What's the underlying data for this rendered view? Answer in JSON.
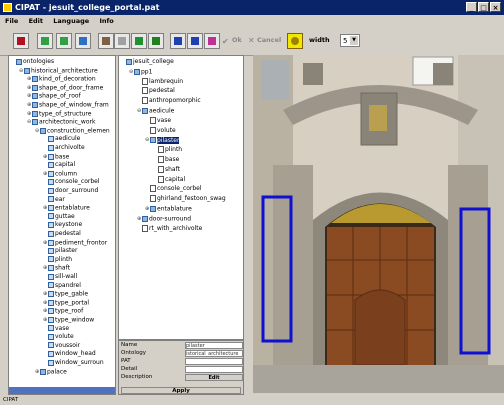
{
  "window": {
    "title": "CIPAT - jesuit_college_portal.pat",
    "min": "_",
    "max": "□",
    "close": "×"
  },
  "menu": [
    "File",
    "Edit",
    "Language",
    "Info"
  ],
  "toolbar": {
    "ok_label": "Ok",
    "cancel_label": "Cancel",
    "width_label": "width",
    "width_value": "5"
  },
  "left_tree": [
    {
      "t": "ontologies",
      "d": 0,
      "tog": "",
      "ic": "fold"
    },
    {
      "t": "historical_architecture",
      "d": 1,
      "tog": "⊖",
      "ic": "fold"
    },
    {
      "t": "kind_of_decoration",
      "d": 2,
      "tog": "⊕",
      "ic": "fold"
    },
    {
      "t": "shape_of_door_frame",
      "d": 2,
      "tog": "⊕",
      "ic": "fold"
    },
    {
      "t": "shape_of_roof",
      "d": 2,
      "tog": "⊕",
      "ic": "fold"
    },
    {
      "t": "shape_of_window_fram",
      "d": 2,
      "tog": "⊕",
      "ic": "fold"
    },
    {
      "t": "type_of_structure",
      "d": 2,
      "tog": "⊕",
      "ic": "fold"
    },
    {
      "t": "architectonic_work",
      "d": 2,
      "tog": "⊖",
      "ic": "fold"
    },
    {
      "t": "construction_elemen",
      "d": 3,
      "tog": "⊖",
      "ic": "fold"
    },
    {
      "t": "aedicule",
      "d": 4,
      "tog": "",
      "ic": "c"
    },
    {
      "t": "archivolte",
      "d": 4,
      "tog": "",
      "ic": "c"
    },
    {
      "t": "base",
      "d": 4,
      "tog": "⊕",
      "ic": "c"
    },
    {
      "t": "capital",
      "d": 4,
      "tog": "",
      "ic": "c"
    },
    {
      "t": "column",
      "d": 4,
      "tog": "⊕",
      "ic": "c"
    },
    {
      "t": "console_corbel",
      "d": 4,
      "tog": "",
      "ic": "c"
    },
    {
      "t": "door_surround",
      "d": 4,
      "tog": "",
      "ic": "c"
    },
    {
      "t": "ear",
      "d": 4,
      "tog": "",
      "ic": "c"
    },
    {
      "t": "entablature",
      "d": 4,
      "tog": "⊕",
      "ic": "c"
    },
    {
      "t": "guttae",
      "d": 4,
      "tog": "",
      "ic": "c"
    },
    {
      "t": "keystone",
      "d": 4,
      "tog": "",
      "ic": "c"
    },
    {
      "t": "pedestal",
      "d": 4,
      "tog": "",
      "ic": "c"
    },
    {
      "t": "pediment_frontor",
      "d": 4,
      "tog": "⊕",
      "ic": "c"
    },
    {
      "t": "pilaster",
      "d": 4,
      "tog": "",
      "ic": "c"
    },
    {
      "t": "plinth",
      "d": 4,
      "tog": "",
      "ic": "c"
    },
    {
      "t": "shaft",
      "d": 4,
      "tog": "⊕",
      "ic": "c"
    },
    {
      "t": "sill-wall",
      "d": 4,
      "tog": "",
      "ic": "c"
    },
    {
      "t": "spandrel",
      "d": 4,
      "tog": "",
      "ic": "c"
    },
    {
      "t": "type_gable",
      "d": 4,
      "tog": "⊕",
      "ic": "c"
    },
    {
      "t": "type_portal",
      "d": 4,
      "tog": "⊕",
      "ic": "c"
    },
    {
      "t": "type_roof",
      "d": 4,
      "tog": "⊕",
      "ic": "c"
    },
    {
      "t": "type_window",
      "d": 4,
      "tog": "⊕",
      "ic": "c"
    },
    {
      "t": "vase",
      "d": 4,
      "tog": "",
      "ic": "c"
    },
    {
      "t": "volute",
      "d": 4,
      "tog": "",
      "ic": "c"
    },
    {
      "t": "voussoir",
      "d": 4,
      "tog": "",
      "ic": "c"
    },
    {
      "t": "window_head",
      "d": 4,
      "tog": "",
      "ic": "c"
    },
    {
      "t": "window_surroun",
      "d": 4,
      "tog": "",
      "ic": "c"
    },
    {
      "t": "palace",
      "d": 3,
      "tog": "⊕",
      "ic": "fold"
    }
  ],
  "middle_tree": [
    {
      "t": "jesuit_college",
      "d": 0,
      "tog": "",
      "ic": "fold"
    },
    {
      "t": "pp1",
      "d": 1,
      "tog": "⊖",
      "ic": "fold"
    },
    {
      "t": "lambrequin",
      "d": 2,
      "tog": "",
      "ic": "doc"
    },
    {
      "t": "pedestal",
      "d": 2,
      "tog": "",
      "ic": "doc"
    },
    {
      "t": "anthropomorphic",
      "d": 2,
      "tog": "",
      "ic": "doc"
    },
    {
      "t": "aedicule",
      "d": 2,
      "tog": "⊖",
      "ic": "fold"
    },
    {
      "t": "vase",
      "d": 3,
      "tog": "",
      "ic": "doc"
    },
    {
      "t": "volute",
      "d": 3,
      "tog": "",
      "ic": "doc"
    },
    {
      "t": "pilaster",
      "d": 3,
      "tog": "⊖",
      "ic": "fold",
      "sel": true
    },
    {
      "t": "plinth",
      "d": 4,
      "tog": "",
      "ic": "doc"
    },
    {
      "t": "base",
      "d": 4,
      "tog": "",
      "ic": "doc"
    },
    {
      "t": "shaft",
      "d": 4,
      "tog": "",
      "ic": "doc"
    },
    {
      "t": "capital",
      "d": 4,
      "tog": "",
      "ic": "doc"
    },
    {
      "t": "console_corbel",
      "d": 3,
      "tog": "",
      "ic": "doc"
    },
    {
      "t": "ghirland_festoon_swag",
      "d": 3,
      "tog": "",
      "ic": "doc"
    },
    {
      "t": "entablature",
      "d": 3,
      "tog": "⊕",
      "ic": "fold"
    },
    {
      "t": "door-surround",
      "d": 2,
      "tog": "⊕",
      "ic": "fold"
    },
    {
      "t": "rt_with_archivolte",
      "d": 2,
      "tog": "",
      "ic": "doc"
    }
  ],
  "properties": {
    "name_label": "Name",
    "name_value": "pilaster",
    "ontology_label": "Ontology",
    "ontology_value": "istorical_architecture",
    "pat_label": "PAT",
    "pat_value": "",
    "detail_label": "Detail",
    "detail_value": "",
    "description_label": "Description",
    "edit_label": "Edit",
    "apply_label": "Apply"
  },
  "statusbar": {
    "text": "CIPAT"
  },
  "colors": {
    "title_bg": "#0a246a",
    "selection": "#0a246a",
    "annotation_box": "#1010d0"
  }
}
